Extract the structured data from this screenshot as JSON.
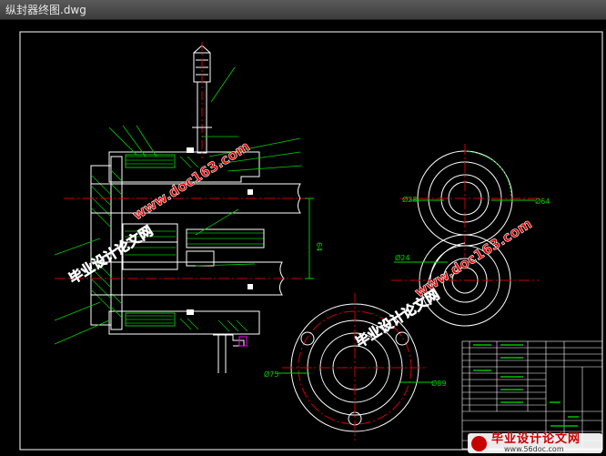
{
  "window": {
    "title": "纵封器终图.dwg"
  },
  "dimensions": {
    "d28": "Ø28",
    "d64": "Ø64",
    "d24": "Ø24",
    "d75": "Ø75",
    "d89": "Ø89",
    "v64": "64"
  },
  "watermarks": {
    "url": "www.doc163.com",
    "cn": "毕业设计论文网"
  },
  "footer": {
    "cn": "毕业设计论文网",
    "url": "www.56doc.com"
  },
  "colors": {
    "background": "#000000",
    "outline": "#ffffff",
    "center_line": "#d00000",
    "hatch": "#00c000",
    "leader": "#00d000",
    "watermark": "#e00000"
  }
}
